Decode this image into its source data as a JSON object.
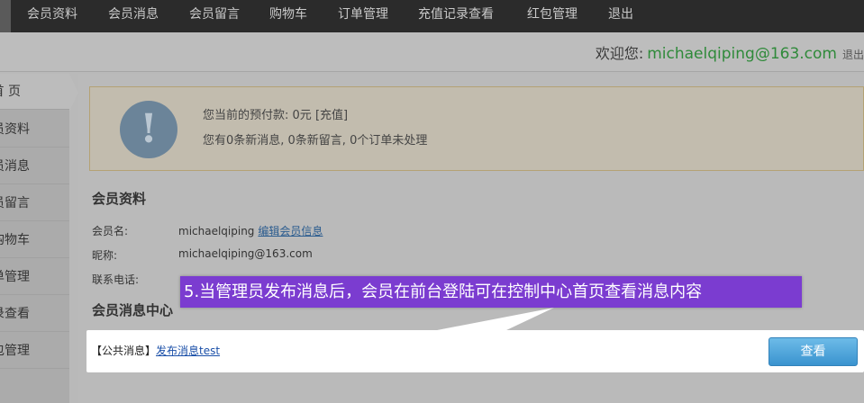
{
  "topnav": {
    "items": [
      "会员资料",
      "会员消息",
      "会员留言",
      "购物车",
      "订单管理",
      "充值记录查看",
      "红包管理",
      "退出"
    ]
  },
  "welcome": {
    "label": "欢迎您:",
    "email": "michaelqiping@163.com",
    "logout": "退出"
  },
  "sidebar": {
    "items": [
      "首 页",
      "会员资料",
      "会员消息",
      "会员留言",
      "购物车",
      "订单管理",
      "充值记录查看",
      "红包管理"
    ]
  },
  "notice": {
    "balance_text": "您当前的预付款: 0元",
    "charge_link": "[充值]",
    "summary": "您有0条新消息, 0条新留言, 0个订单未处理"
  },
  "profile": {
    "title": "会员资料",
    "username_label": "会员名:",
    "username": "michaelqiping",
    "edit_link": "编辑会员信息",
    "nickname_label": "昵称:",
    "nickname": "michaelqiping@163.com",
    "phone_label": "联系电话:"
  },
  "messages": {
    "title": "会员消息中心",
    "tag": "【公共消息】",
    "item_link": "发布消息test",
    "view_button": "查看"
  },
  "callout": {
    "text": "5.当管理员发布消息后，会员在前台登陆可在控制中心首页查看消息内容"
  },
  "colors": {
    "callout": "#7b3cd0",
    "accent_green": "#2f8a3a",
    "button_blue": "#3a93cf"
  }
}
